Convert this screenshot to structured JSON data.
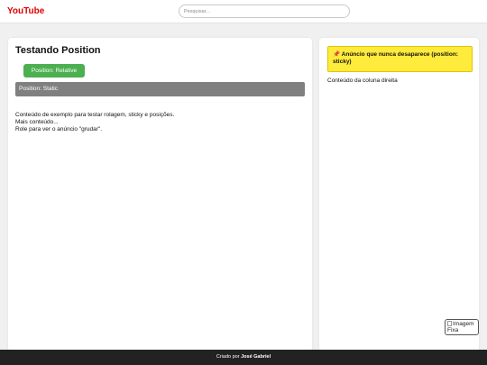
{
  "header": {
    "logo": "YouTube",
    "search_placeholder": "Pesquisar..."
  },
  "main": {
    "title": "Testando Position",
    "relative_label": "Position: Relative",
    "static_label": "Position: Static",
    "content_lines": [
      "Conteúdo de exemplo para testar rolagem, sticky e posições.",
      "Mais conteúdo...",
      "Role para ver o anúncio \"grudar\"."
    ]
  },
  "sidebar": {
    "sticky_ad_icon": "pushpin-icon",
    "sticky_ad_text": "📌 Anúncio que nunca desaparece (position: sticky)",
    "content": "Conteúdo da coluna direita"
  },
  "fixed_image": {
    "alt_text": "Imagem Fixa"
  },
  "footer": {
    "prefix": "Criado por ",
    "author": "José Gabriel"
  },
  "colors": {
    "logo": "#e00000",
    "relative_bg": "#4caf50",
    "static_bg": "#808080",
    "sticky_bg": "#ffeb3b",
    "footer_bg": "#222222",
    "page_bg": "#f0f0f0"
  }
}
